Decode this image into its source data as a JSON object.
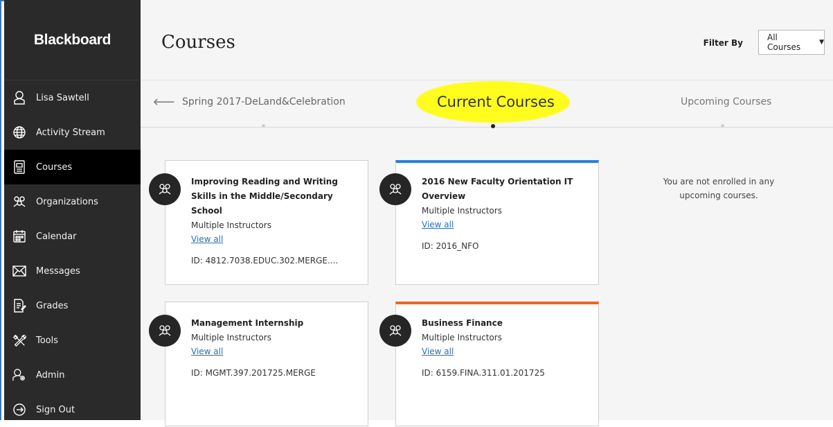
{
  "sidebar": {
    "brand": "Blackboard",
    "items": [
      {
        "label": "Lisa Sawtell",
        "icon": "user-icon"
      },
      {
        "label": "Activity Stream",
        "icon": "globe-icon"
      },
      {
        "label": "Courses",
        "icon": "courses-icon",
        "active": true
      },
      {
        "label": "Organizations",
        "icon": "organizations-icon"
      },
      {
        "label": "Calendar",
        "icon": "calendar-icon"
      },
      {
        "label": "Messages",
        "icon": "envelope-icon"
      },
      {
        "label": "Grades",
        "icon": "grades-icon"
      },
      {
        "label": "Tools",
        "icon": "tools-icon"
      },
      {
        "label": "Admin",
        "icon": "admin-icon"
      },
      {
        "label": "Sign Out",
        "icon": "sign-out-icon"
      }
    ]
  },
  "header": {
    "title": "Courses",
    "filter_label": "Filter By",
    "filter_value": "All Courses"
  },
  "terms": {
    "previous": "Spring 2017-DeLand&Celebration",
    "current": "Current Courses",
    "next": "Upcoming Courses"
  },
  "courses": [
    {
      "title": "Improving Reading and Writing Skills in the Middle/Secondary School",
      "instructors": "Multiple Instructors",
      "link": "View all",
      "id": "ID: 4812.7038.EDUC.302.MERGE...."
    },
    {
      "title": "2016 New Faculty Orientation IT Overview",
      "instructors": "Multiple Instructors",
      "link": "View all",
      "id": "ID: 2016_NFO",
      "accent": "#2d7be0"
    },
    {
      "title": "Management Internship",
      "instructors": "Multiple Instructors",
      "link": "View all",
      "id": "ID: MGMT.397.201725.MERGE"
    },
    {
      "title": "Business Finance",
      "instructors": "Multiple Instructors",
      "link": "View all",
      "id": "ID: 6159.FINA.311.01.201725",
      "accent": "#f0641e"
    }
  ],
  "upcoming": {
    "message": "You are not enrolled in any upcoming courses."
  },
  "colors": {
    "sidebar_bg": "#2a2a2a",
    "active_bg": "#000000",
    "highlight": "#fffc1e",
    "link": "#2b6fb5"
  }
}
